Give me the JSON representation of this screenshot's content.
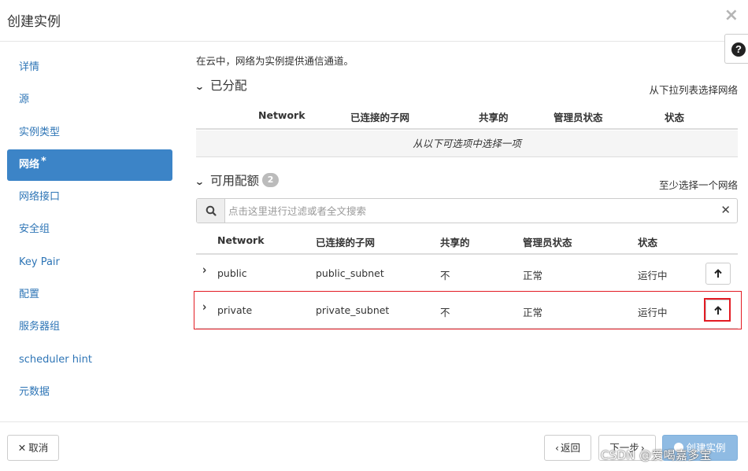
{
  "modal": {
    "title": "创建实例",
    "close_icon": "×"
  },
  "help": {
    "icon": "?"
  },
  "sidebar": {
    "items": [
      {
        "label": "详情"
      },
      {
        "label": "源"
      },
      {
        "label": "实例类型"
      },
      {
        "label": "网络",
        "required_mark": "*",
        "active": true
      },
      {
        "label": "网络接口"
      },
      {
        "label": "安全组"
      },
      {
        "label": "Key Pair"
      },
      {
        "label": "配置"
      },
      {
        "label": "服务器组"
      },
      {
        "label": "scheduler hint"
      },
      {
        "label": "元数据"
      }
    ]
  },
  "main": {
    "intro": "在云中，网络为实例提供通信通道。",
    "allocated": {
      "title": "已分配",
      "hint": "从下拉列表选择网络",
      "columns": [
        "Network",
        "已连接的子网",
        "共享的",
        "管理员状态",
        "状态"
      ],
      "empty_text": "从以下可选项中选择一项"
    },
    "available": {
      "title": "可用配额",
      "count": "2",
      "hint": "至少选择一个网络",
      "search_placeholder": "点击这里进行过滤或者全文搜索",
      "columns": [
        "Network",
        "已连接的子网",
        "共享的",
        "管理员状态",
        "状态"
      ],
      "rows": [
        {
          "network": "public",
          "subnet": "public_subnet",
          "shared": "不",
          "admin_state": "正常",
          "status": "运行中"
        },
        {
          "network": "private",
          "subnet": "private_subnet",
          "shared": "不",
          "admin_state": "正常",
          "status": "运行中"
        }
      ]
    }
  },
  "footer": {
    "cancel_label": "取消",
    "back_label": "返回",
    "next_label": "下一步",
    "create_label": "创建实例"
  },
  "watermark": "CSDN @爱喝嘉多宝",
  "colors": {
    "accent": "#3c84c7",
    "link": "#2e75b6",
    "highlight": "#e31b23",
    "primary_disabled": "#8fbbe3"
  }
}
